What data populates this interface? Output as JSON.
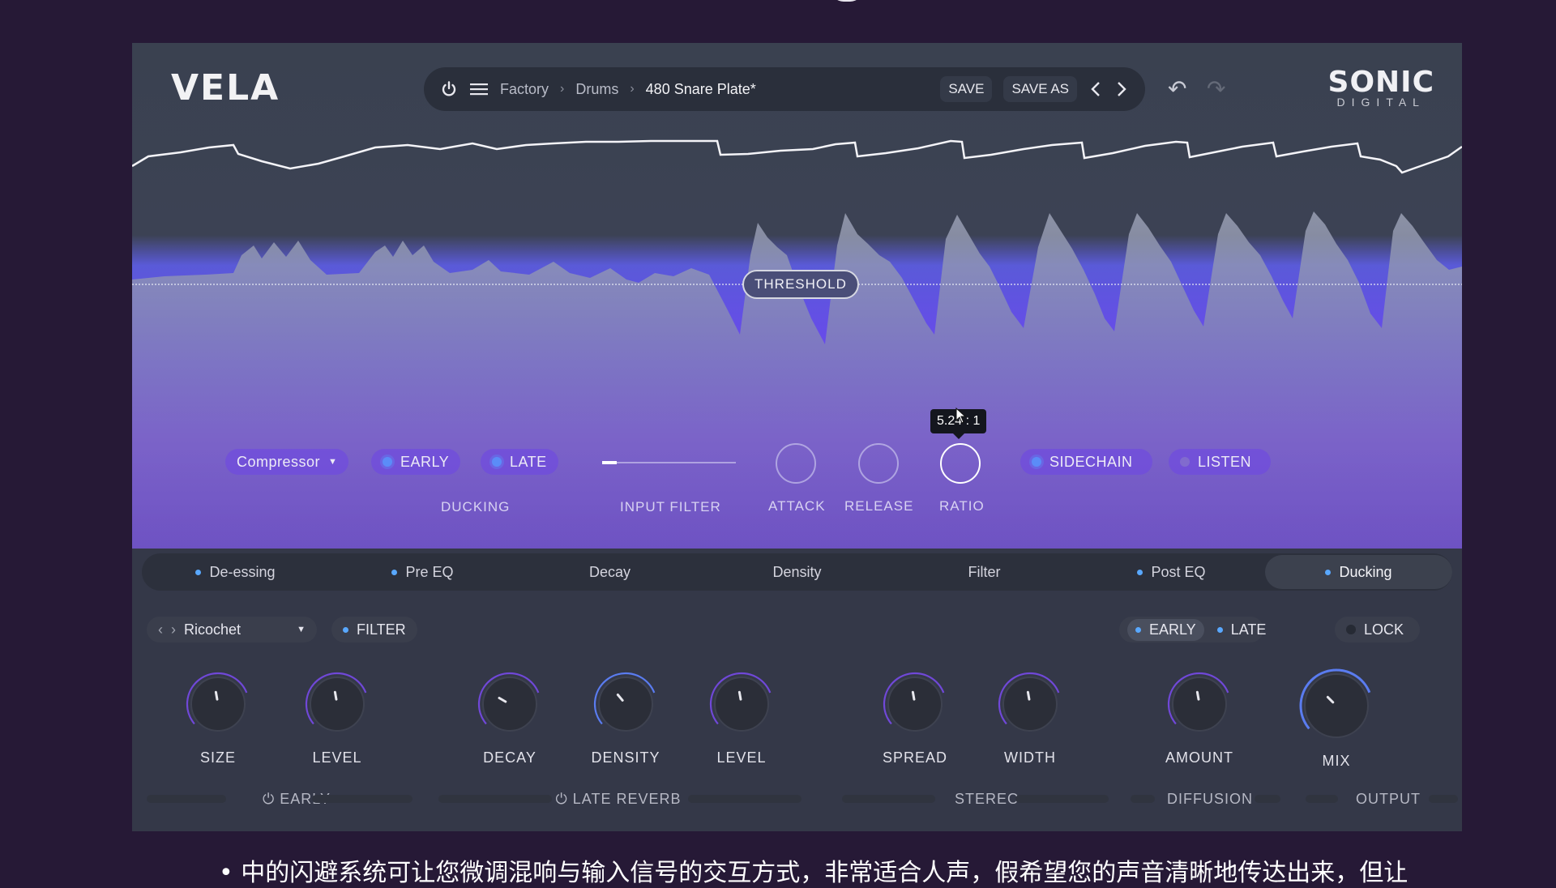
{
  "app": {
    "logo": "VELA",
    "brand_line1": "SONIC",
    "brand_line2": "DIGITAL"
  },
  "topbar": {
    "breadcrumb": [
      "Factory",
      "Drums",
      "480 Snare Plate*"
    ],
    "save_label": "SAVE",
    "save_as_label": "SAVE AS"
  },
  "visualizer": {
    "threshold_label": "THRESHOLD",
    "ratio_tooltip": "5.24 : 1"
  },
  "ducking": {
    "mode": "Compressor",
    "early_label": "EARLY",
    "late_label": "LATE",
    "ducking_label": "DUCKING",
    "input_filter_label": "INPUT FILTER",
    "attack_label": "ATTACK",
    "release_label": "RELEASE",
    "ratio_label": "RATIO",
    "sidechain_label": "SIDECHAIN",
    "listen_label": "LISTEN"
  },
  "tabs": [
    {
      "label": "De-essing",
      "dot": true
    },
    {
      "label": "Pre EQ",
      "dot": true
    },
    {
      "label": "Decay",
      "dot": false
    },
    {
      "label": "Density",
      "dot": false
    },
    {
      "label": "Filter",
      "dot": false
    },
    {
      "label": "Post EQ",
      "dot": true
    },
    {
      "label": "Ducking",
      "dot": true,
      "active": true
    }
  ],
  "controls": {
    "preset": "Ricochet",
    "filter_label": "FILTER",
    "early_label": "EARLY",
    "late_label": "LATE",
    "lock_label": "LOCK"
  },
  "knobs": [
    {
      "label": "SIZE"
    },
    {
      "label": "LEVEL"
    },
    {
      "label": "DECAY"
    },
    {
      "label": "DENSITY"
    },
    {
      "label": "LEVEL"
    },
    {
      "label": "SPREAD"
    },
    {
      "label": "WIDTH"
    },
    {
      "label": "AMOUNT"
    },
    {
      "label": "MIX"
    }
  ],
  "groups": {
    "early": "EARLY",
    "late_reverb": "LATE REVERB",
    "stereo": "STEREO",
    "diffusion": "DIFFUSION",
    "output": "OUTPUT"
  },
  "subtitle": "• 中的闪避系统可让您微调混响与输入信号的交互方式，非常适合人声，假希望您的声音清晰地传达出来，但让"
}
